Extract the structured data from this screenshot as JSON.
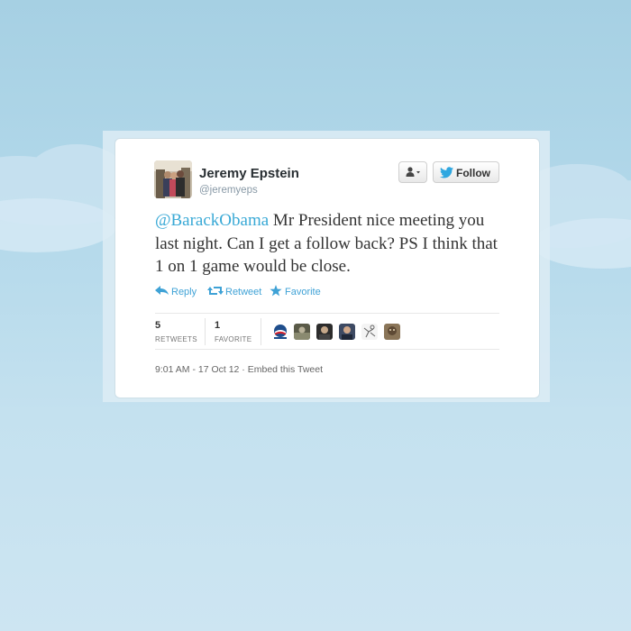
{
  "colors": {
    "background": "#b5d9ea",
    "card": "#ffffff",
    "link": "#39a9d6",
    "text": "#333333"
  },
  "author": {
    "name": "Jeremy Epstein",
    "handle": "@jeremyeps",
    "avatar_icon": "profile-photo"
  },
  "header_buttons": {
    "user_menu_icon": "person-dropdown-icon",
    "follow_label": "Follow"
  },
  "tweet": {
    "mention": "@BarackObama",
    "text": " Mr President nice meeting you last night. Can I get a follow back? PS I think that 1 on 1 game would be close."
  },
  "actions": {
    "reply": "Reply",
    "retweet": "Retweet",
    "favorite": "Favorite"
  },
  "stats": {
    "retweets_count": "5",
    "retweets_label": "RETWEETS",
    "favorites_count": "1",
    "favorites_label": "FAVORITE"
  },
  "favoriters": [
    "obama-logo-avatar",
    "photo-avatar",
    "photo-avatar",
    "photo-avatar",
    "sketch-avatar",
    "photo-avatar"
  ],
  "meta": {
    "timestamp": "9:01 AM - 17 Oct 12",
    "separator": " · ",
    "embed": "Embed this Tweet"
  }
}
